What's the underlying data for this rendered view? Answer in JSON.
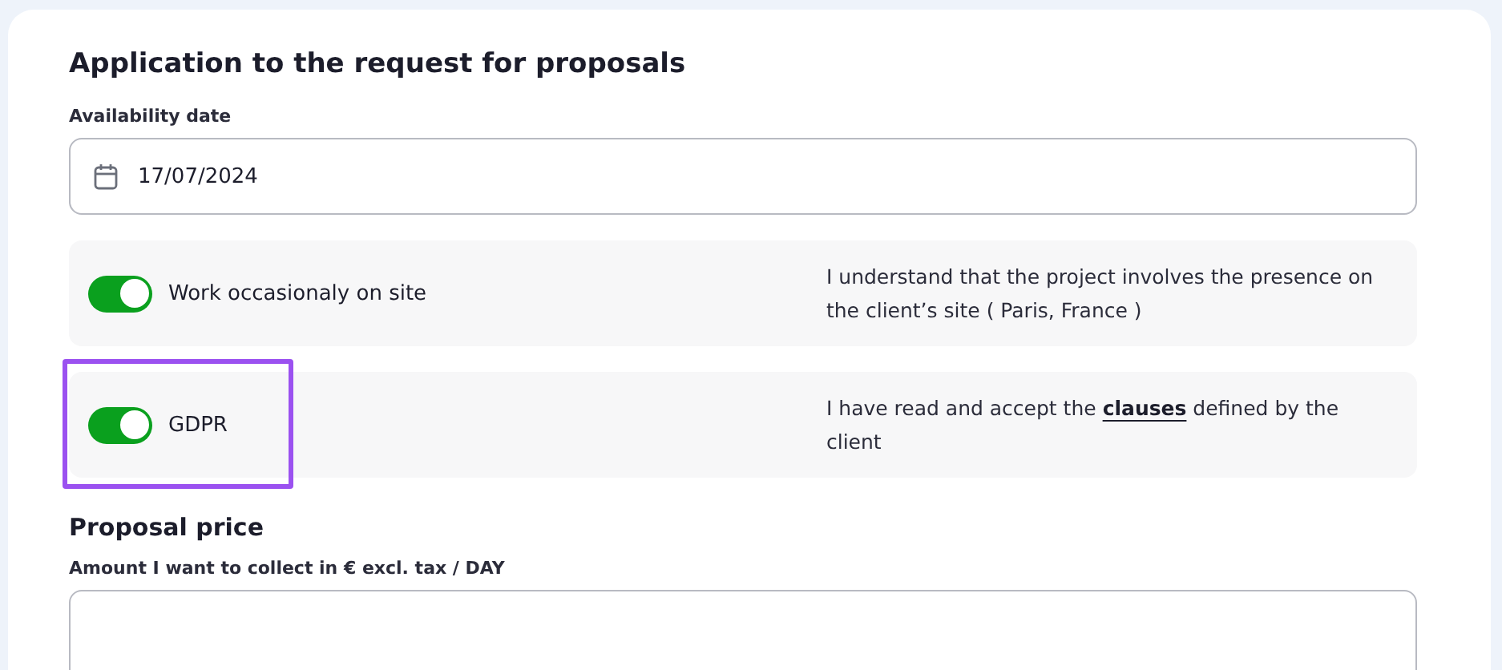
{
  "form": {
    "title": "Application to the request for proposals",
    "availability": {
      "label": "Availability date",
      "value": "17/07/2024"
    },
    "options": [
      {
        "label": "Work occasionaly on site",
        "on": true,
        "highlighted": false,
        "description": "I understand that the project involves the presence on the client’s site ( Paris, France )"
      },
      {
        "label": "GDPR",
        "on": true,
        "highlighted": true,
        "description": "I have read and accept the",
        "link": "clauses",
        "description_end": "defined by the client"
      }
    ],
    "price": {
      "heading": "Proposal price",
      "label": "Amount I want to collect in € excl. tax / DAY"
    }
  }
}
